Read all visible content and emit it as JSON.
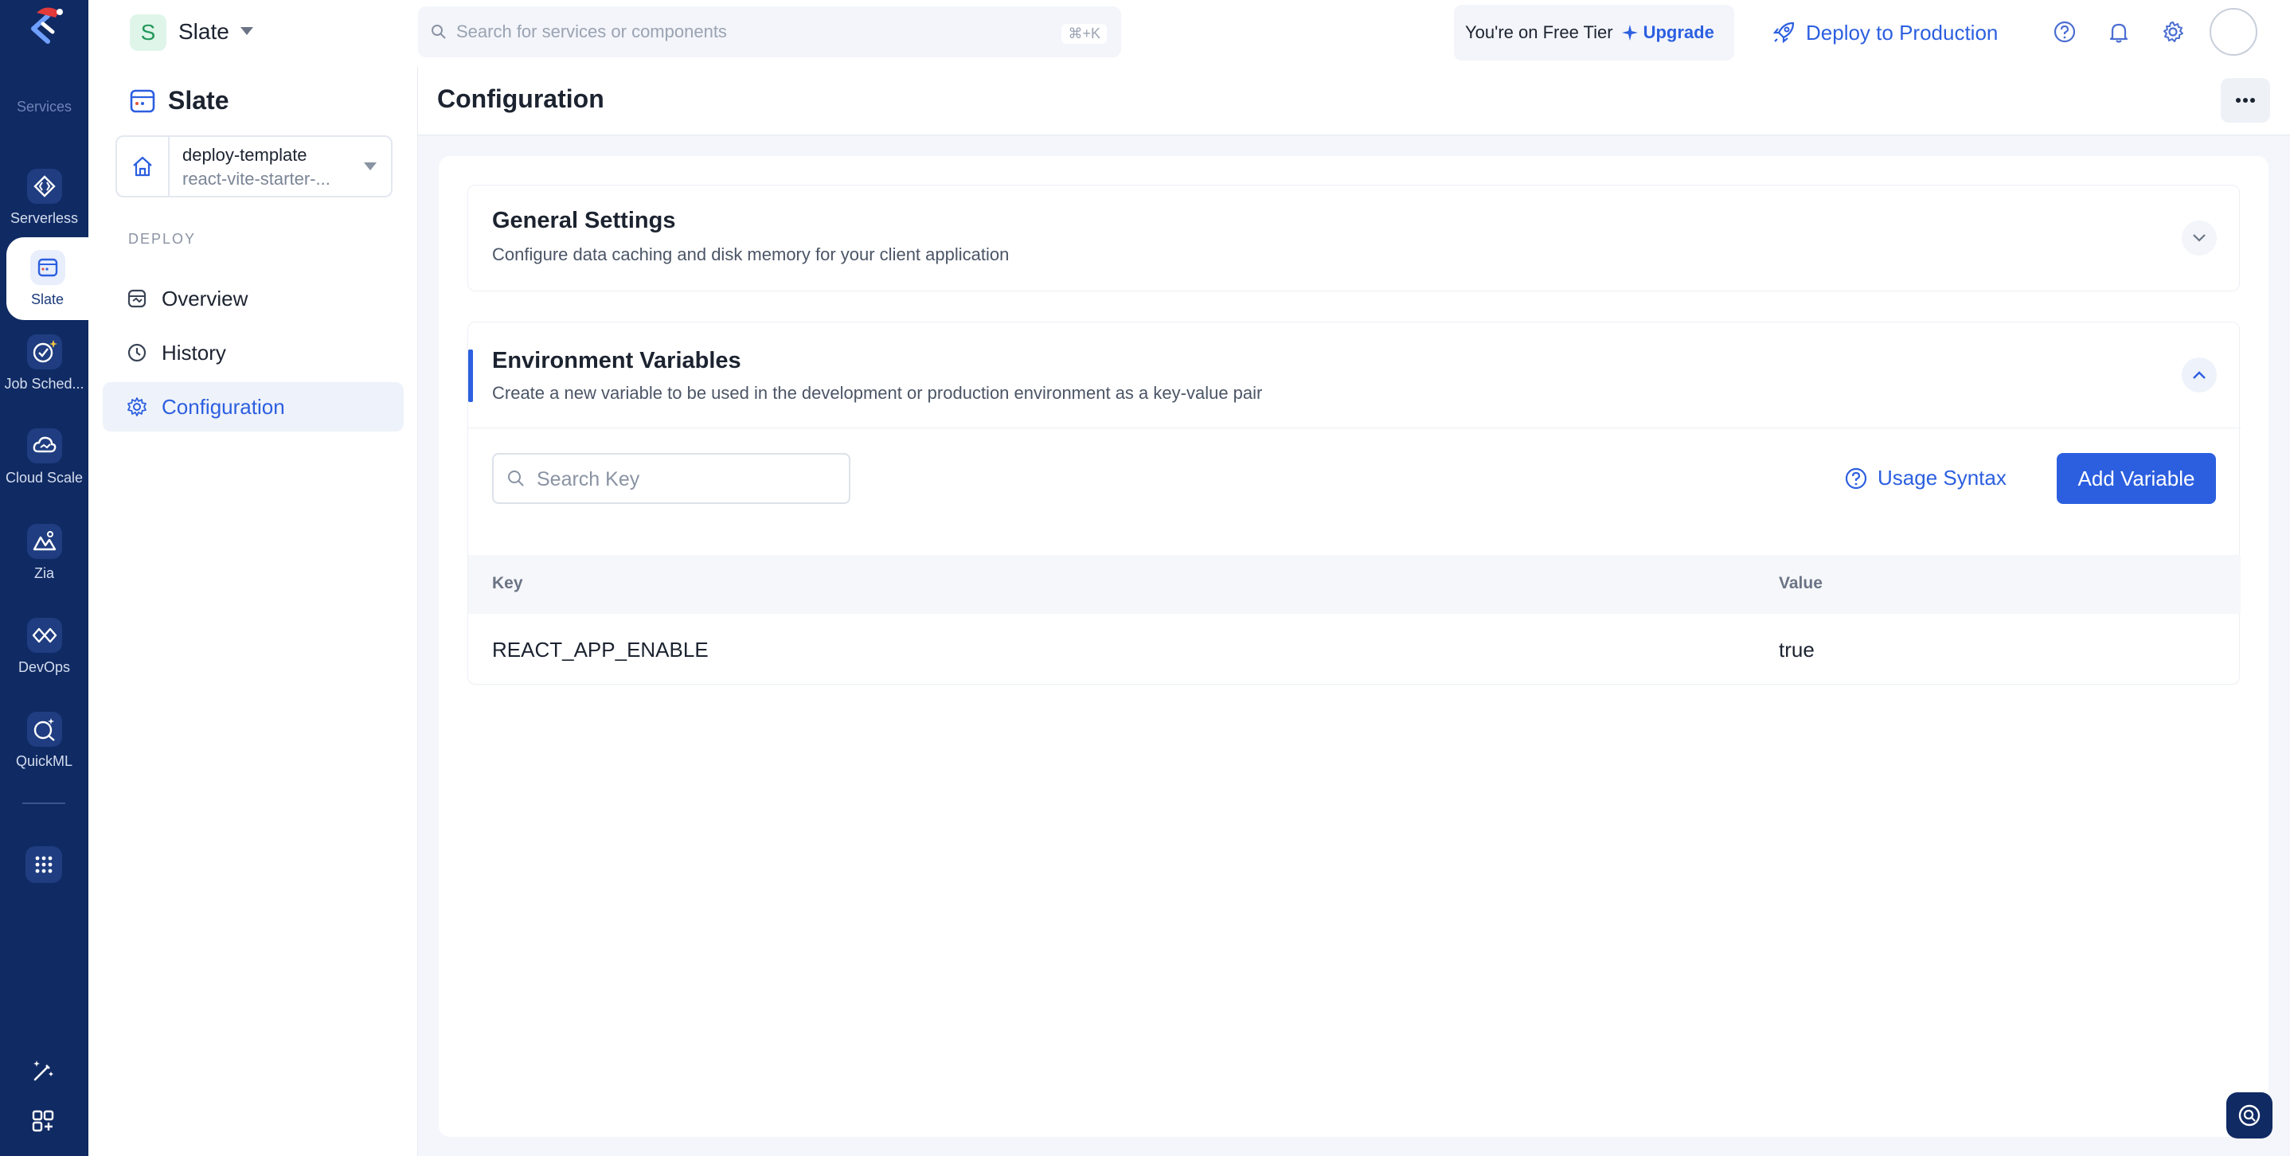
{
  "rail": {
    "services_label": "Services",
    "items": [
      {
        "label": "Serverless",
        "icon": "serverless-icon"
      },
      {
        "label": "Slate",
        "icon": "slate-icon"
      },
      {
        "label": "Job Sched...",
        "icon": "job-scheduling-icon"
      },
      {
        "label": "Cloud Scale",
        "icon": "cloud-scale-icon"
      },
      {
        "label": "Zia",
        "icon": "zia-icon"
      },
      {
        "label": "DevOps",
        "icon": "devops-icon"
      },
      {
        "label": "QuickML",
        "icon": "quickml-icon"
      }
    ]
  },
  "topbar": {
    "project_initial": "S",
    "project_name": "Slate",
    "search_placeholder": "Search for services or components",
    "search_shortcut": "⌘+K",
    "tier_text": "You're on Free Tier",
    "upgrade_label": "Upgrade",
    "deploy_label": "Deploy to Production"
  },
  "sidebar": {
    "title": "Slate",
    "env": {
      "name": "deploy-template",
      "sub": "react-vite-starter-..."
    },
    "section": "DEPLOY",
    "nav": [
      {
        "label": "Overview"
      },
      {
        "label": "History"
      },
      {
        "label": "Configuration"
      }
    ]
  },
  "main": {
    "title": "Configuration",
    "general": {
      "title": "General Settings",
      "desc": "Configure data caching and disk memory for your client application"
    },
    "env_vars": {
      "title": "Environment Variables",
      "desc": "Create a new variable to be used in the development or production environment as a key-value pair",
      "search_placeholder": "Search Key",
      "usage_label": "Usage Syntax",
      "add_label": "Add Variable",
      "columns": {
        "key": "Key",
        "value": "Value"
      },
      "rows": [
        {
          "key": "REACT_APP_ENABLE",
          "value": "true"
        }
      ]
    }
  },
  "colors": {
    "rail": "#102a63",
    "accent": "#2c5fe0"
  }
}
